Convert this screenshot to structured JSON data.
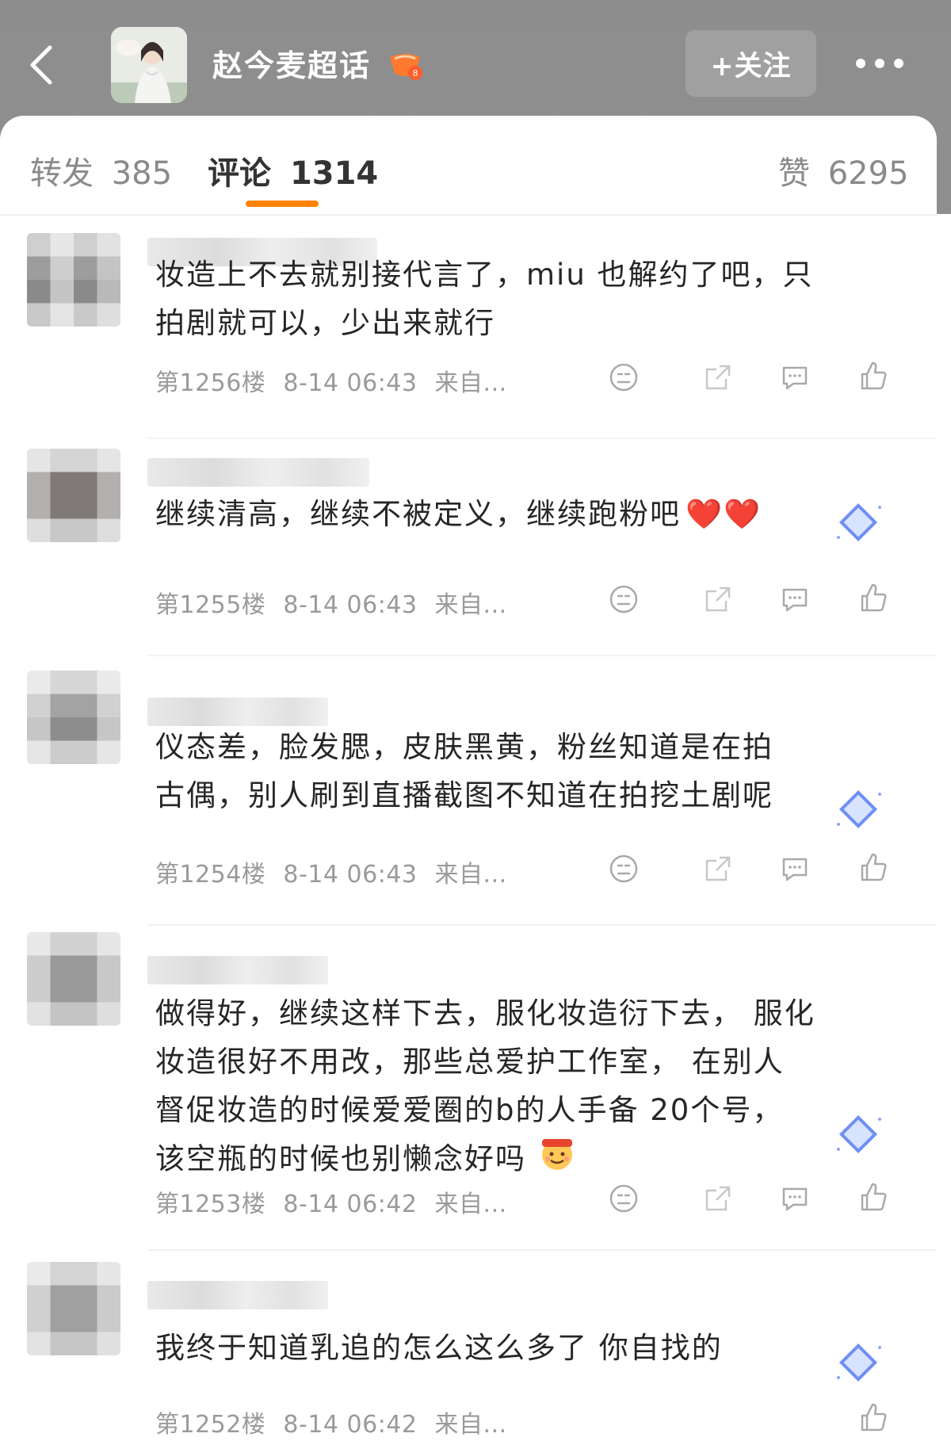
{
  "header": {
    "title": "赵今麦超话",
    "follow_label": "+关注"
  },
  "tabs": [
    {
      "label": "转发",
      "count": "385"
    },
    {
      "label": "评论",
      "count": "1314"
    },
    {
      "label": "赞",
      "count": "6295"
    }
  ],
  "comments": [
    {
      "lines": [
        "妆造上不去就别接代言了，miu 也解约了吧，只",
        "拍剧就可以，少出来就行"
      ],
      "floor": "第1256楼",
      "time": "8-14 06:43",
      "source": "来自..."
    },
    {
      "lines": [
        "继续清高，继续不被定义，继续跑粉吧"
      ],
      "emoji": "❤️❤️",
      "floor": "第1255楼",
      "time": "8-14 06:43",
      "source": "来自..."
    },
    {
      "lines": [
        "仪态差，脸发腮，皮肤黑黄，粉丝知道是在拍",
        "古偶，别人刷到直播截图不知道在拍挖土剧呢"
      ],
      "floor": "第1254楼",
      "time": "8-14 06:43",
      "source": "来自..."
    },
    {
      "lines": [
        "做得好，继续这样下去，服化妆造衍下去， 服化",
        "妆造很好不用改，那些总爱护工作室， 在别人",
        "督促妆造的时候爱爱圈的b的人手备 20个号，",
        "该空瓶的时候也别懒念好吗"
      ],
      "floor": "第1253楼",
      "time": "8-14 06:42",
      "source": "来自..."
    },
    {
      "lines": [
        "我终于知道乳追的怎么这么多了 你自找的"
      ],
      "floor": "第1252楼",
      "time": "8-14 06:42",
      "source": "来自..."
    }
  ],
  "colors": {
    "accent": "#ff8200",
    "header_bg": "#8f8f8f",
    "meta_text": "#9a9a9a"
  },
  "icons": [
    "back-icon",
    "more-icon",
    "dislike-icon",
    "share-icon",
    "reply-icon",
    "like-icon",
    "diamond-badge-icon"
  ]
}
